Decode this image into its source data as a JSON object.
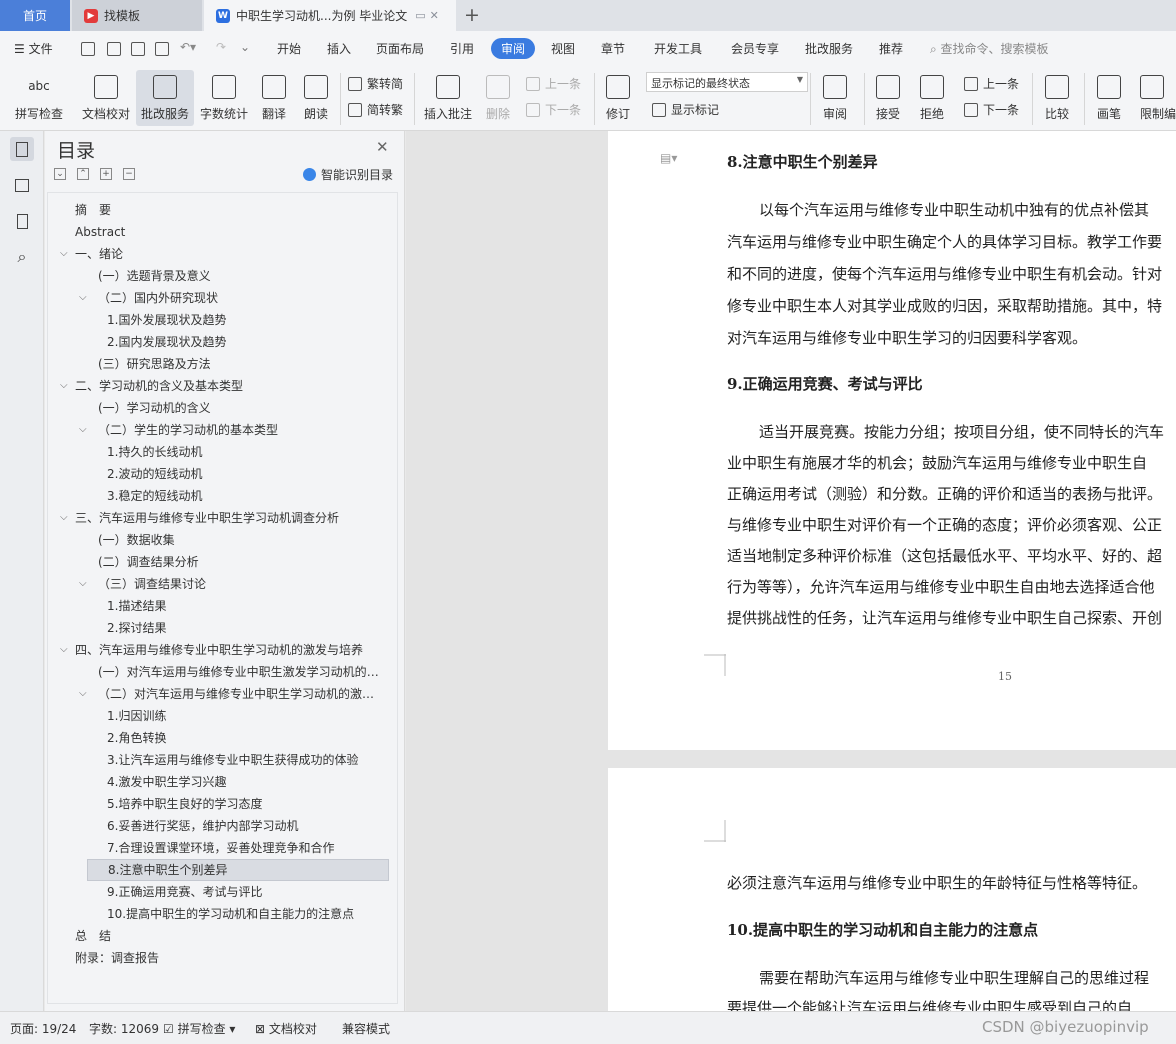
{
  "tabs": {
    "home": "首页",
    "templates": "找模板",
    "document": "中职生学习动机...为例 毕业论文"
  },
  "menu": {
    "file": "文件",
    "items": [
      "开始",
      "插入",
      "页面布局",
      "引用",
      "审阅",
      "视图",
      "章节",
      "开发工具",
      "会员专享",
      "批改服务",
      "推荐"
    ],
    "search_placeholder": "查找命令、搜索模板"
  },
  "ribbon": {
    "spellcheck": "拼写检查",
    "proofread": "文档校对",
    "approve_service": "批改服务",
    "word_count": "字数统计",
    "translate": "翻译",
    "read_aloud": "朗读",
    "trad_to_simp": "繁转简",
    "simp_to_trad": "简转繁",
    "insert_comment": "插入批注",
    "delete": "删除",
    "prev_comment": "上一条",
    "next_comment": "下一条",
    "revise": "修订",
    "markup_state": "显示标记的最终状态",
    "show_markup": "显示标记",
    "review": "审阅",
    "accept": "接受",
    "reject": "拒绝",
    "prev_change": "上一条",
    "next_change": "下一条",
    "compare": "比较",
    "ink": "画笔",
    "restrict": "限制编"
  },
  "toc": {
    "title": "目录",
    "smart_label": "智能识别目录",
    "items": [
      "摘　要",
      "Abstract",
      "一、绪论",
      "(一）选题背景及意义",
      "（二）国内外研究现状",
      "1.国外发展现状及趋势",
      "2.国内发展现状及趋势",
      "(三）研究思路及方法",
      "二、学习动机的含义及基本类型",
      "(一）学习动机的含义",
      "（二）学生的学习动机的基本类型",
      "1.持久的长线动机",
      "2.波动的短线动机",
      "3.稳定的短线动机",
      "三、汽车运用与维修专业中职生学习动机调查分析",
      "(一）数据收集",
      "(二）调查结果分析",
      "（三）调查结果讨论",
      "1.描述结果",
      "2.探讨结果",
      "四、汽车运用与维修专业中职生学习动机的激发与培养",
      "(一）对汽车运用与维修专业中职生激发学习动机的注意点",
      "（二）对汽车运用与维修专业中职生学习动机的激发与培养",
      "1.归因训练",
      "2.角色转换",
      "3.让汽车运用与维修专业中职生获得成功的体验",
      "4.激发中职生学习兴趣",
      "5.培养中职生良好的学习态度",
      "6.妥善进行奖惩，维护内部学习动机",
      "7.合理设置课堂环境，妥善处理竞争和合作",
      "8.注意中职生个别差异",
      "9.正确运用竞赛、考试与评比",
      "10.提高中职生的学习动机和自主能力的注意点",
      "总　结",
      "附录：调查报告"
    ]
  },
  "document": {
    "heading8": "8.注意中职生个别差异",
    "para8": [
      "以每个汽车运用与维修专业中职生动机中独有的优点补偿其",
      "汽车运用与维修专业中职生确定个人的具体学习目标。教学工作要",
      "和不同的进度，使每个汽车运用与维修专业中职生有机会动。针对",
      "修专业中职生本人对其学业成败的归因，采取帮助措施。其中，特",
      "对汽车运用与维修专业中职生学习的归因要科学客观。"
    ],
    "heading9": "9.正确运用竞赛、考试与评比",
    "para9": [
      "适当开展竞赛。按能力分组；按项目分组，使不同特长的汽车",
      "业中职生有施展才华的机会；鼓励汽车运用与维修专业中职生自",
      "正确运用考试（测验）和分数。正确的评价和适当的表扬与批评。",
      "与维修专业中职生对评价有一个正确的态度；评价必须客观、公正",
      "适当地制定多种评价标准（这包括最低水平、平均水平、好的、超",
      "行为等等），允许汽车运用与维修专业中职生自由地去选择适合他",
      "提供挑战性的任务，让汽车运用与维修专业中职生自己探索、开创"
    ],
    "page_number": "15",
    "page2_line1": "必须注意汽车运用与维修专业中职生的年龄特征与性格等特征。",
    "heading10": "10.提高中职生的学习动机和自主能力的注意点",
    "para10": [
      "需要在帮助汽车运用与维修专业中职生理解自己的思维过程",
      "要提供一个能够让汽车运用与维修专业中职生感受到自己的自"
    ]
  },
  "status": {
    "page": "页面: 19/24",
    "words": "字数: 12069",
    "spellcheck": "拼写检查",
    "proofread": "文档校对",
    "compat": "兼容模式"
  },
  "watermark": "CSDN @biyezuopinvip",
  "colors": {
    "accent": "#3a7be0",
    "tab_home": "#4b7fd9"
  }
}
